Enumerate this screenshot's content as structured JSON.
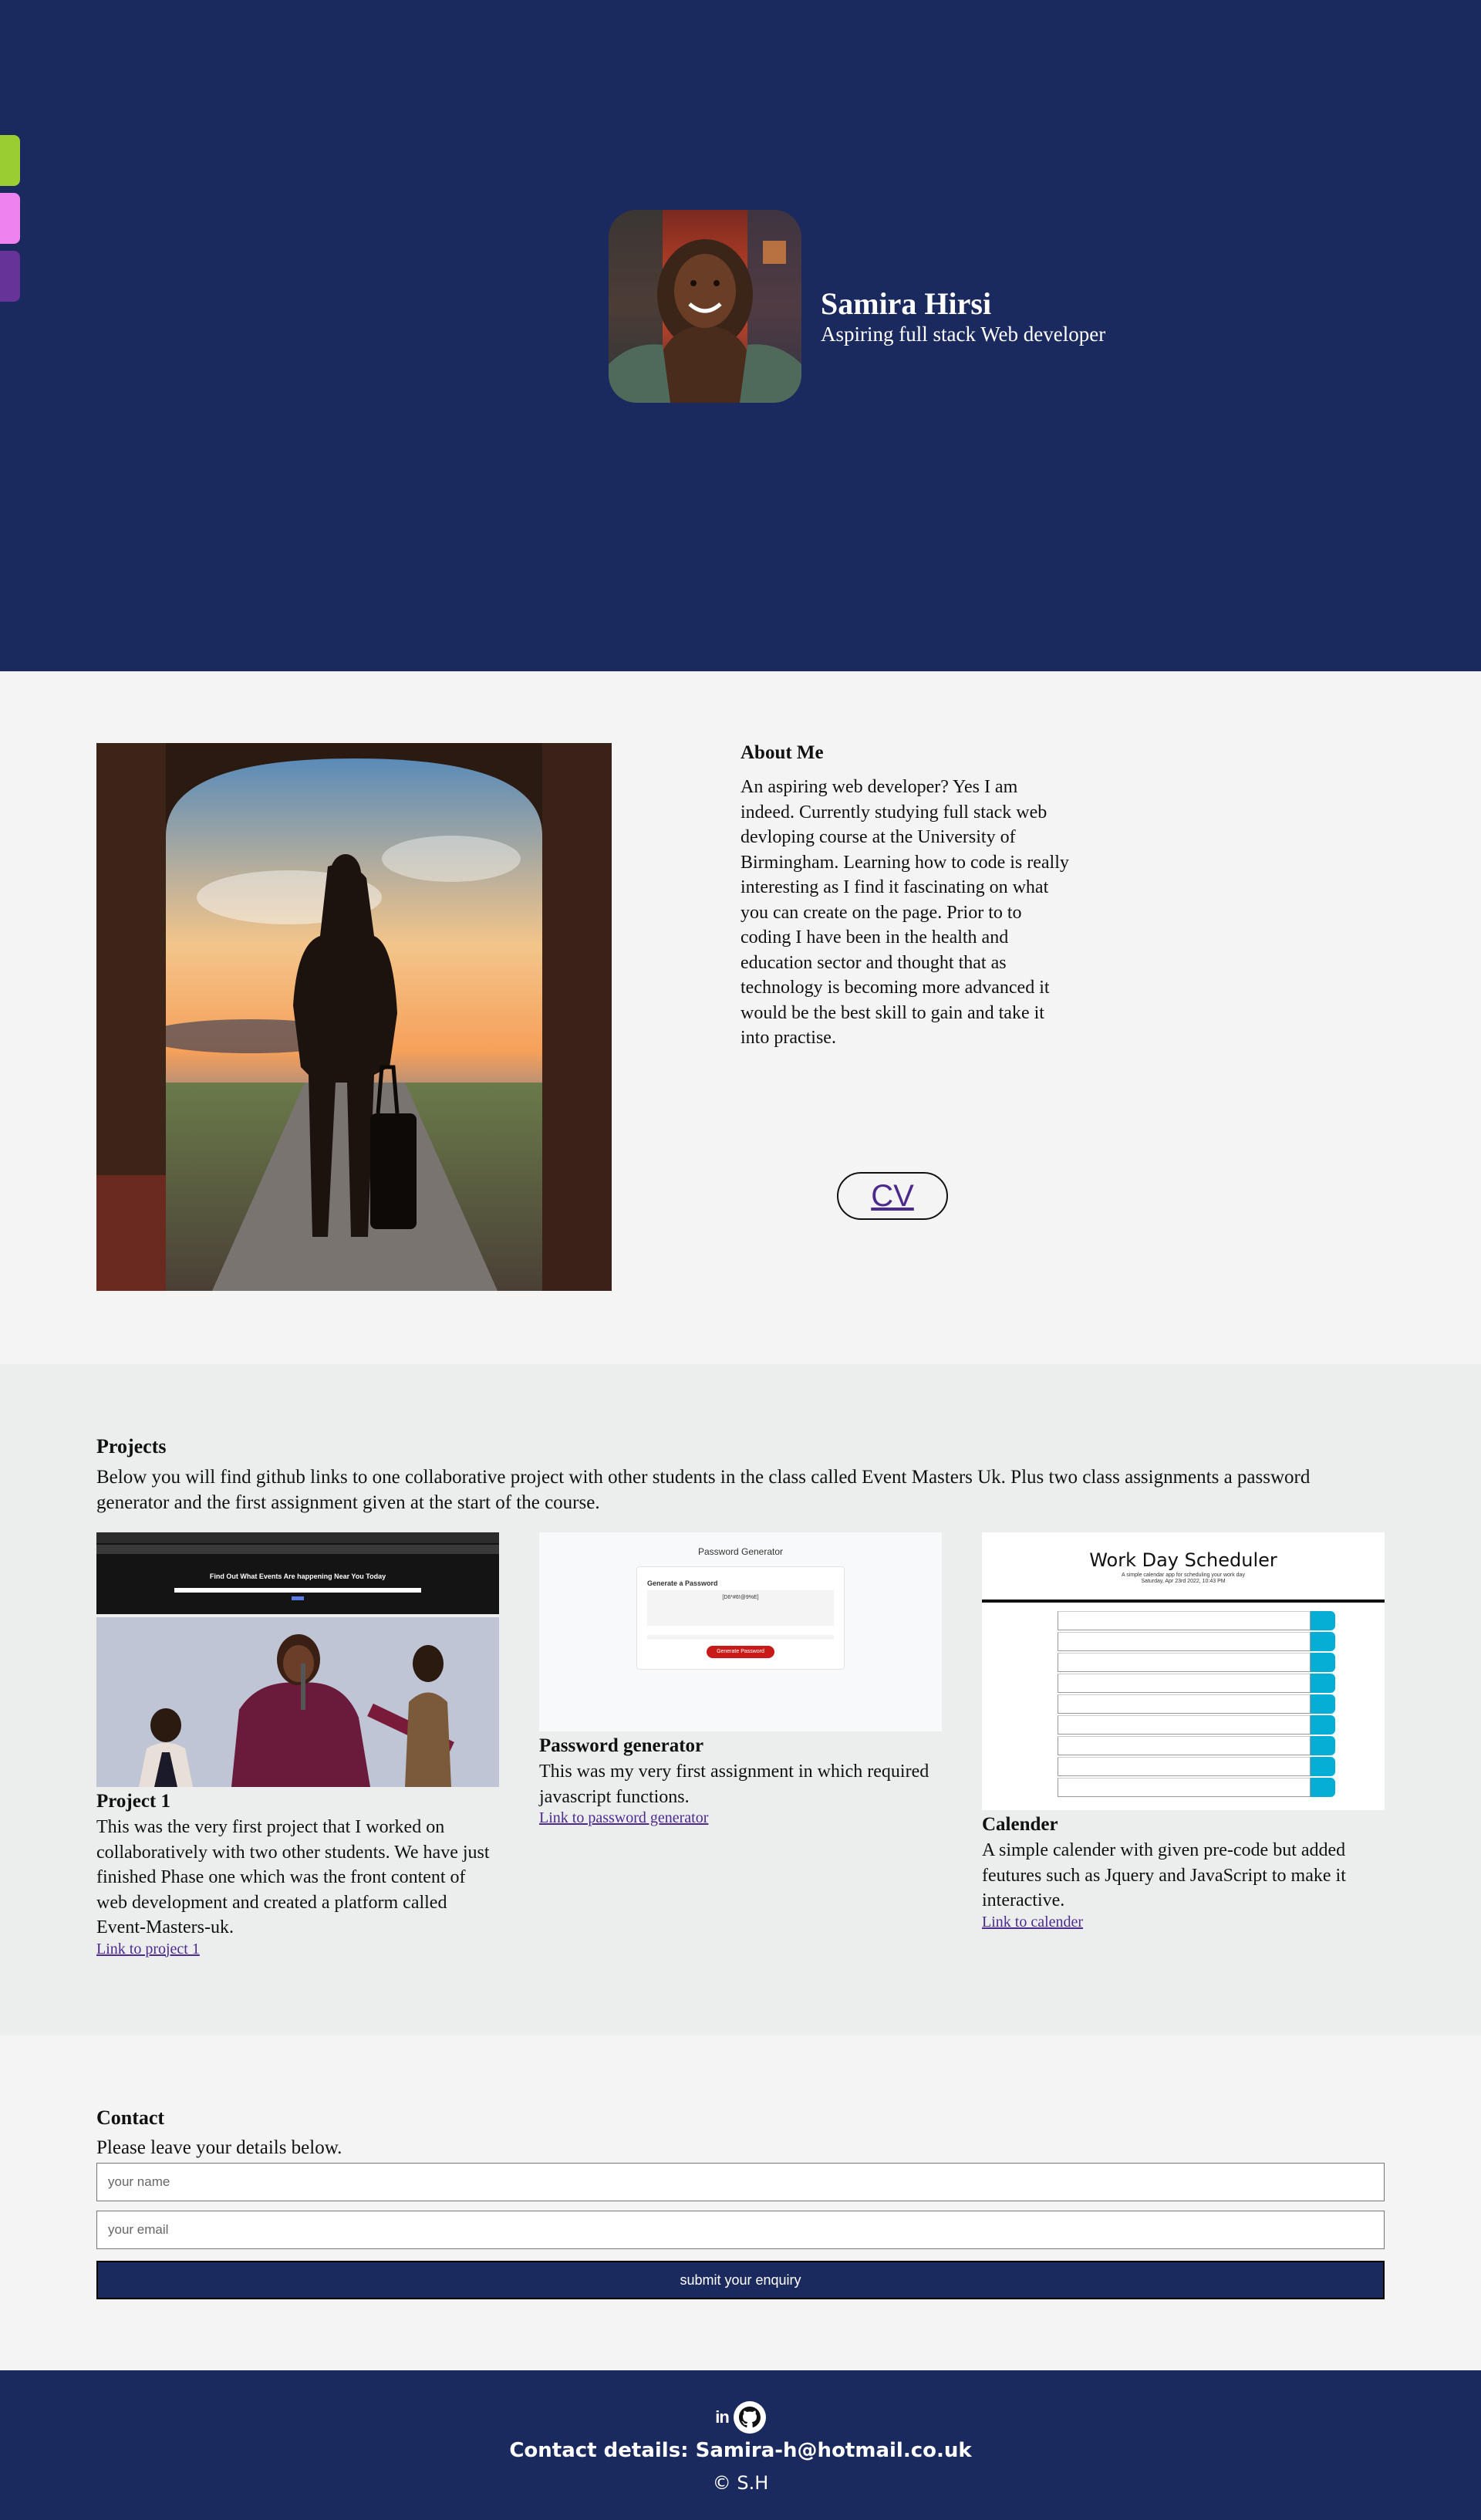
{
  "side_tabs": [
    {
      "name": "theme-tab-green",
      "color": "#9acd32"
    },
    {
      "name": "theme-tab-pink",
      "color": "#ee82ee"
    },
    {
      "name": "theme-tab-purple",
      "color": "#663399"
    }
  ],
  "hero": {
    "name": "Samira Hirsi",
    "subtitle": "Aspiring full stack Web developer",
    "background": "#1b2a5e"
  },
  "about": {
    "heading": "About Me",
    "text": "An aspiring web developer? Yes I am indeed. Currently studying full stack web devloping course at the University of Birmingham. Learning how to code is really interesting as I find it fascinating on what you can create on the page. Prior to to coding I have been in the health and education sector and thought that as technology is becoming more advanced it would be the best skill to gain and take it into practise.",
    "cv_label": "CV"
  },
  "projects": {
    "heading": "Projects",
    "intro": "Below you will find github links to one collaborative project with other students in the class called Event Masters Uk. Plus two class assignments a password generator and the first assignment given at the start of the course.",
    "items": [
      {
        "title": "Project 1",
        "description": "This was the very first project that I worked on collaboratively with two other students. We have just finished Phase one which was the front content of web development and created a platform called Event-Masters-uk.",
        "link": "Link to project 1",
        "shot_heading": "Find Out What Events Are happening Near You Today"
      },
      {
        "title": "Password generator",
        "description": "This was my very first assignment in which required javascript functions.",
        "link": "Link to password generator",
        "shot_title": "Password Generator",
        "shot_card_title": "Generate a Password",
        "shot_password": "[D6*#6!@9%E]",
        "shot_button": "Generate Password"
      },
      {
        "title": "Calender",
        "description": "A simple calender with given pre-code but added feutures such as Jquery and JavaScript to make it interactive.",
        "link": "Link to calender",
        "shot_title": "Work Day Scheduler",
        "shot_sub": "A simple calendar app for scheduling your work day",
        "shot_date": "Saturday, Apr 23rd 2022, 10:43 PM"
      }
    ]
  },
  "contact": {
    "heading": "Contact",
    "text": "Please leave your details below.",
    "name_placeholder": "your name",
    "email_placeholder": "your email",
    "submit_label": "submit your enquiry"
  },
  "footer": {
    "linkedin_label": "in",
    "contact_details": "Contact details: Samira-h@hotmail.co.uk",
    "copyright": "© S.H"
  }
}
